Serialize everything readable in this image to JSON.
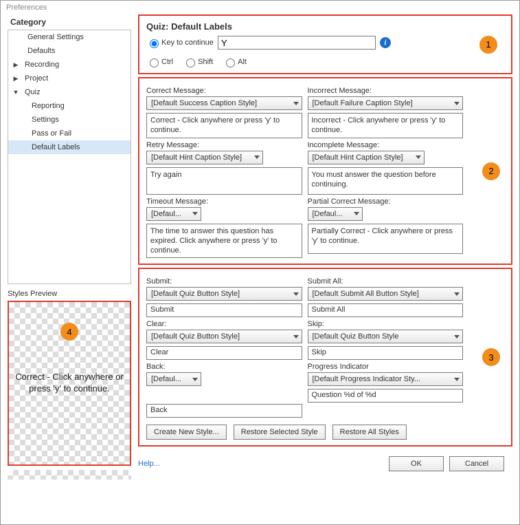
{
  "window": {
    "title": "Preferences"
  },
  "category": {
    "header": "Category",
    "items": [
      {
        "label": "General Settings",
        "lvl": 1,
        "twist": ""
      },
      {
        "label": "Defaults",
        "lvl": 1,
        "twist": ""
      },
      {
        "label": "Recording",
        "lvl": 1,
        "twist": "▶"
      },
      {
        "label": "Project",
        "lvl": 1,
        "twist": "▶"
      },
      {
        "label": "Quiz",
        "lvl": 1,
        "twist": "▼"
      },
      {
        "label": "Reporting",
        "lvl": 2,
        "twist": ""
      },
      {
        "label": "Settings",
        "lvl": 2,
        "twist": ""
      },
      {
        "label": "Pass or Fail",
        "lvl": 2,
        "twist": ""
      },
      {
        "label": "Default Labels",
        "lvl": 2,
        "twist": "",
        "sel": true
      }
    ]
  },
  "styles_preview": {
    "header": "Styles Preview",
    "text": "Correct - Click anywhere or press 'y' to continue."
  },
  "s1": {
    "heading": "Quiz: Default Labels",
    "key_label": "Key to continue",
    "key_value": "Y",
    "ctrl": "Ctrl",
    "shift": "Shift",
    "alt": "Alt",
    "badge": "1"
  },
  "s2": {
    "correct_lbl": "Correct Message:",
    "correct_style": "[Default Success Caption Style]",
    "correct_text": "Correct - Click anywhere or press 'y' to continue.",
    "incorrect_lbl": "Incorrect Message:",
    "incorrect_style": "[Default Failure Caption Style]",
    "incorrect_text": "Incorrect - Click anywhere or press 'y' to continue.",
    "retry_lbl": "Retry Message:",
    "retry_style": "[Default Hint Caption Style]",
    "retry_text": "Try again",
    "incomplete_lbl": "Incomplete Message:",
    "incomplete_style": "[Default Hint Caption Style]",
    "incomplete_text": "You must answer the question before continuing.",
    "timeout_lbl": "Timeout Message:",
    "timeout_style": "[Defaul...",
    "timeout_text": "The time to answer this question has expired. Click anywhere or press 'y' to continue.",
    "partial_lbl": "Partial Correct Message:",
    "partial_style": "[Defaul...",
    "partial_text": "Partially Correct - Click anywhere or press 'y' to continue.",
    "badge": "2"
  },
  "s3": {
    "submit_lbl": "Submit:",
    "submit_style": "[Default Quiz Button Style]",
    "submit_text": "Submit",
    "submitall_lbl": "Submit All:",
    "submitall_style": "[Default Submit All Button Style]",
    "submitall_text": "Submit All",
    "clear_lbl": "Clear:",
    "clear_style": "[Default Quiz Button Style]",
    "clear_text": "Clear",
    "skip_lbl": "Skip:",
    "skip_style": "[Default Quiz Button Style",
    "skip_text": "Skip",
    "back_lbl": "Back:",
    "back_style": "[Defaul...",
    "back_text": "Back",
    "prog_lbl": "Progress Indicator",
    "prog_style": "[Default Progress Indicator Sty...",
    "prog_text": "Question %d of %d",
    "btn_create": "Create New Style...",
    "btn_restore_sel": "Restore Selected Style",
    "btn_restore_all": "Restore All Styles",
    "badge": "3"
  },
  "s4": {
    "badge": "4"
  },
  "footer": {
    "help": "Help...",
    "ok": "OK",
    "cancel": "Cancel"
  }
}
